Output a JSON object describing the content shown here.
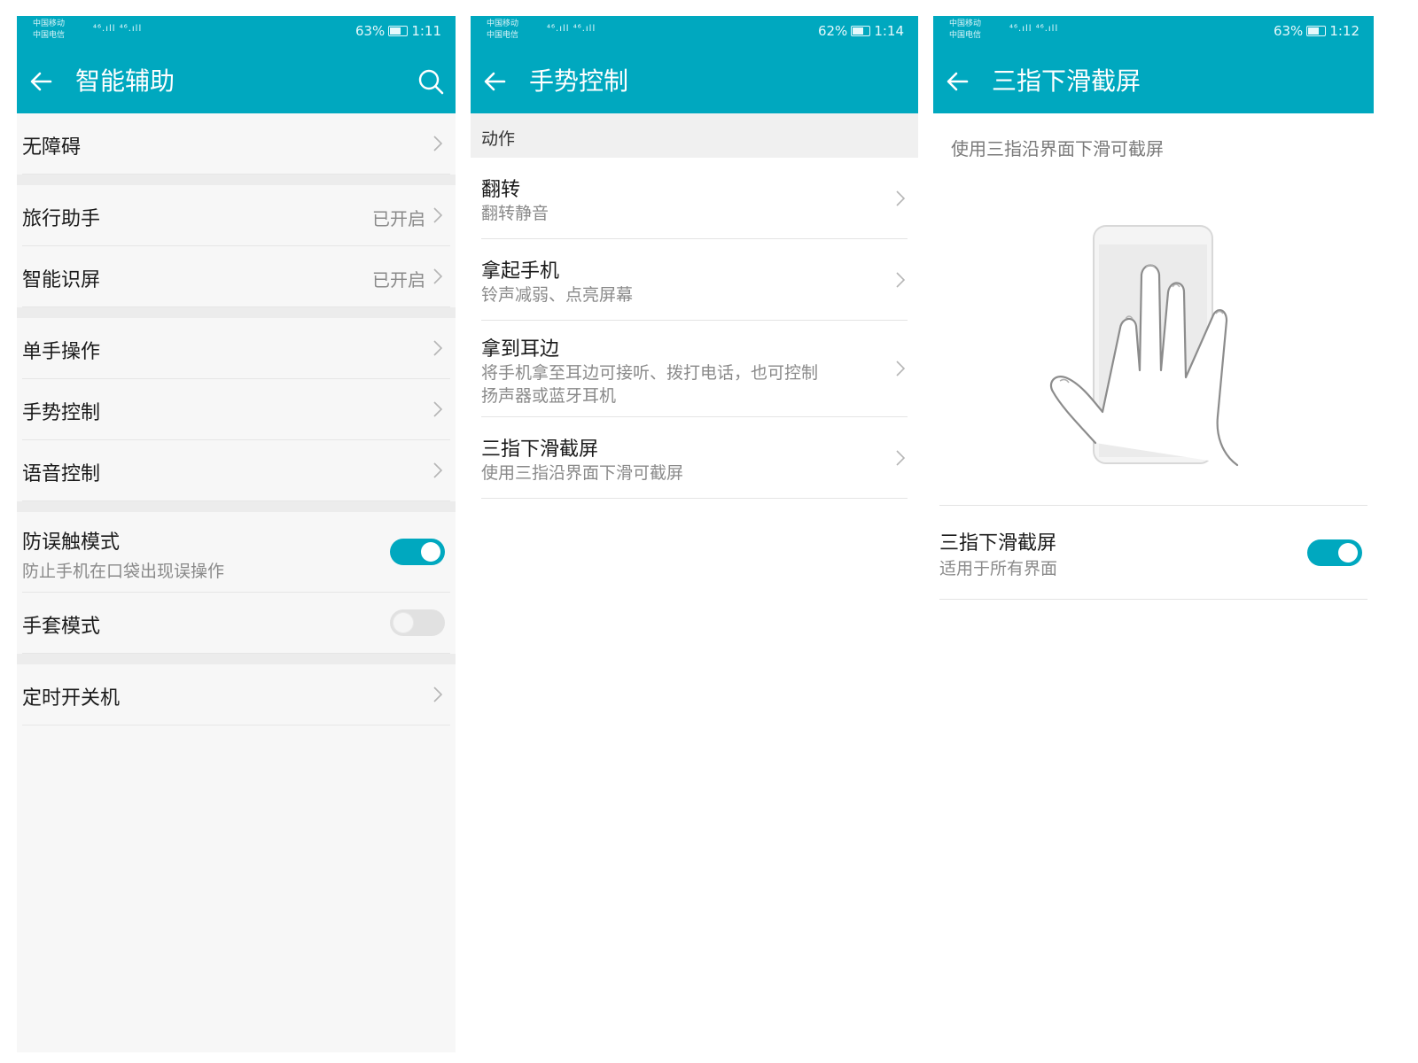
{
  "screens": [
    {
      "status": {
        "carrier1": "中国移动",
        "carrier2": "中国电信",
        "signal": "⁴⁶.ıll ⁴⁶.ıll",
        "battery": "63%",
        "time": "1:11"
      },
      "title": "智能辅助",
      "back_icon": "arrow-left-icon",
      "search_icon": "search-icon",
      "items": [
        {
          "label": "无障碍"
        },
        {
          "label": "旅行助手",
          "value": "已开启"
        },
        {
          "label": "智能识屏",
          "value": "已开启"
        },
        {
          "label": "单手操作"
        },
        {
          "label": "手势控制"
        },
        {
          "label": "语音控制"
        },
        {
          "label": "防误触模式",
          "sub": "防止手机在口袋出现误操作",
          "toggle": "on"
        },
        {
          "label": "手套模式",
          "toggle": "off"
        },
        {
          "label": "定时开关机"
        }
      ]
    },
    {
      "status": {
        "carrier1": "中国移动",
        "carrier2": "中国电信",
        "signal": "⁴⁶.ıll ⁴⁶.ıll",
        "battery": "62%",
        "time": "1:14"
      },
      "title": "手势控制",
      "section": "动作",
      "items": [
        {
          "label": "翻转",
          "sub": "翻转静音"
        },
        {
          "label": "拿起手机",
          "sub": "铃声减弱、点亮屏幕"
        },
        {
          "label": "拿到耳边",
          "sub1": "将手机拿至耳边可接听、拨打电话，也可控制",
          "sub2": "扬声器或蓝牙耳机"
        },
        {
          "label": "三指下滑截屏",
          "sub": "使用三指沿界面下滑可截屏"
        }
      ]
    },
    {
      "status": {
        "carrier1": "中国移动",
        "carrier2": "中国电信",
        "signal": "⁴⁶.ıll ⁴⁶.ıll",
        "battery": "63%",
        "time": "1:12"
      },
      "title": "三指下滑截屏",
      "description": "使用三指沿界面下滑可截屏",
      "illustration": "hand-on-phone-illustration",
      "setting": {
        "label": "三指下滑截屏",
        "sub": "适用于所有界面",
        "toggle": "on"
      }
    }
  ],
  "colors": {
    "accent": "#00a8bf",
    "background": "#f7f7f7"
  }
}
